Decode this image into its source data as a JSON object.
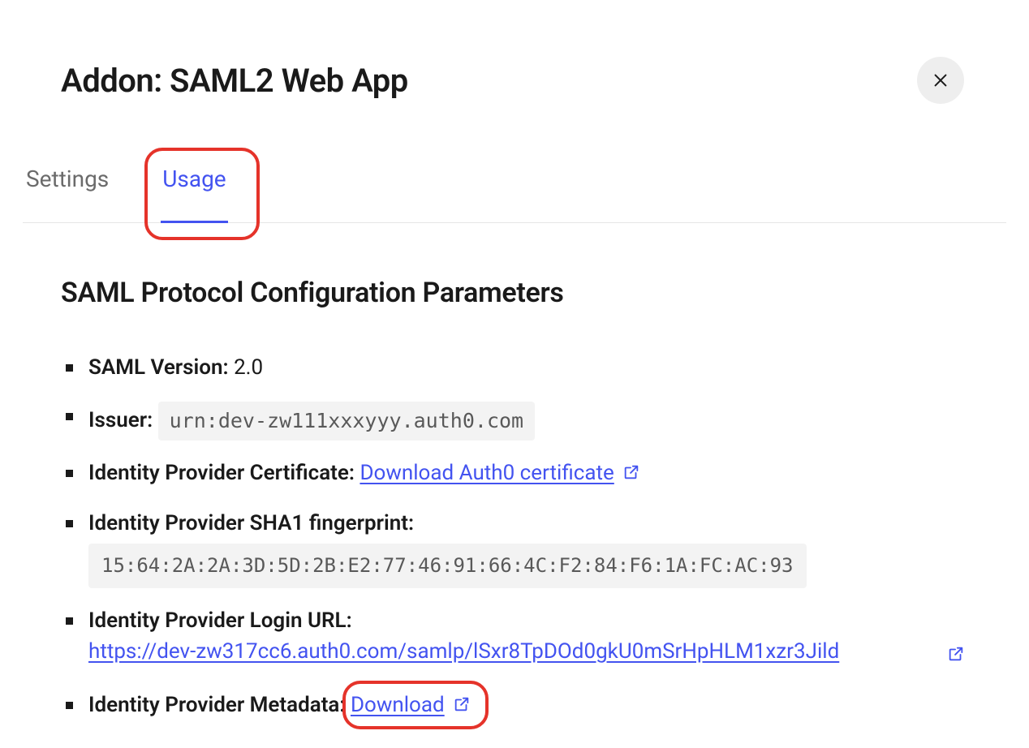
{
  "header": {
    "title": "Addon: SAML2 Web App"
  },
  "tabs": [
    {
      "label": "Settings",
      "active": false
    },
    {
      "label": "Usage",
      "active": true
    }
  ],
  "section": {
    "title": "SAML Protocol Configuration Parameters"
  },
  "params": {
    "saml_version": {
      "label": "SAML Version:",
      "value": "2.0"
    },
    "issuer": {
      "label": "Issuer:",
      "value": "urn:dev-zw111xxxyyy.auth0.com"
    },
    "idp_cert": {
      "label": "Identity Provider Certificate:",
      "link_text": "Download Auth0 certificate"
    },
    "sha1_fp": {
      "label": "Identity Provider SHA1 fingerprint:",
      "value": "15:64:2A:2A:3D:5D:2B:E2:77:46:91:66:4C:F2:84:F6:1A:FC:AC:93"
    },
    "login_url": {
      "label": "Identity Provider Login URL:",
      "link_text": "https://dev-zw317cc6.auth0.com/samlp/lSxr8TpDOd0gkU0mSrHpHLM1xzr3Jild"
    },
    "metadata": {
      "label": "Identity Provider Metadata:",
      "link_text": "Download"
    }
  }
}
